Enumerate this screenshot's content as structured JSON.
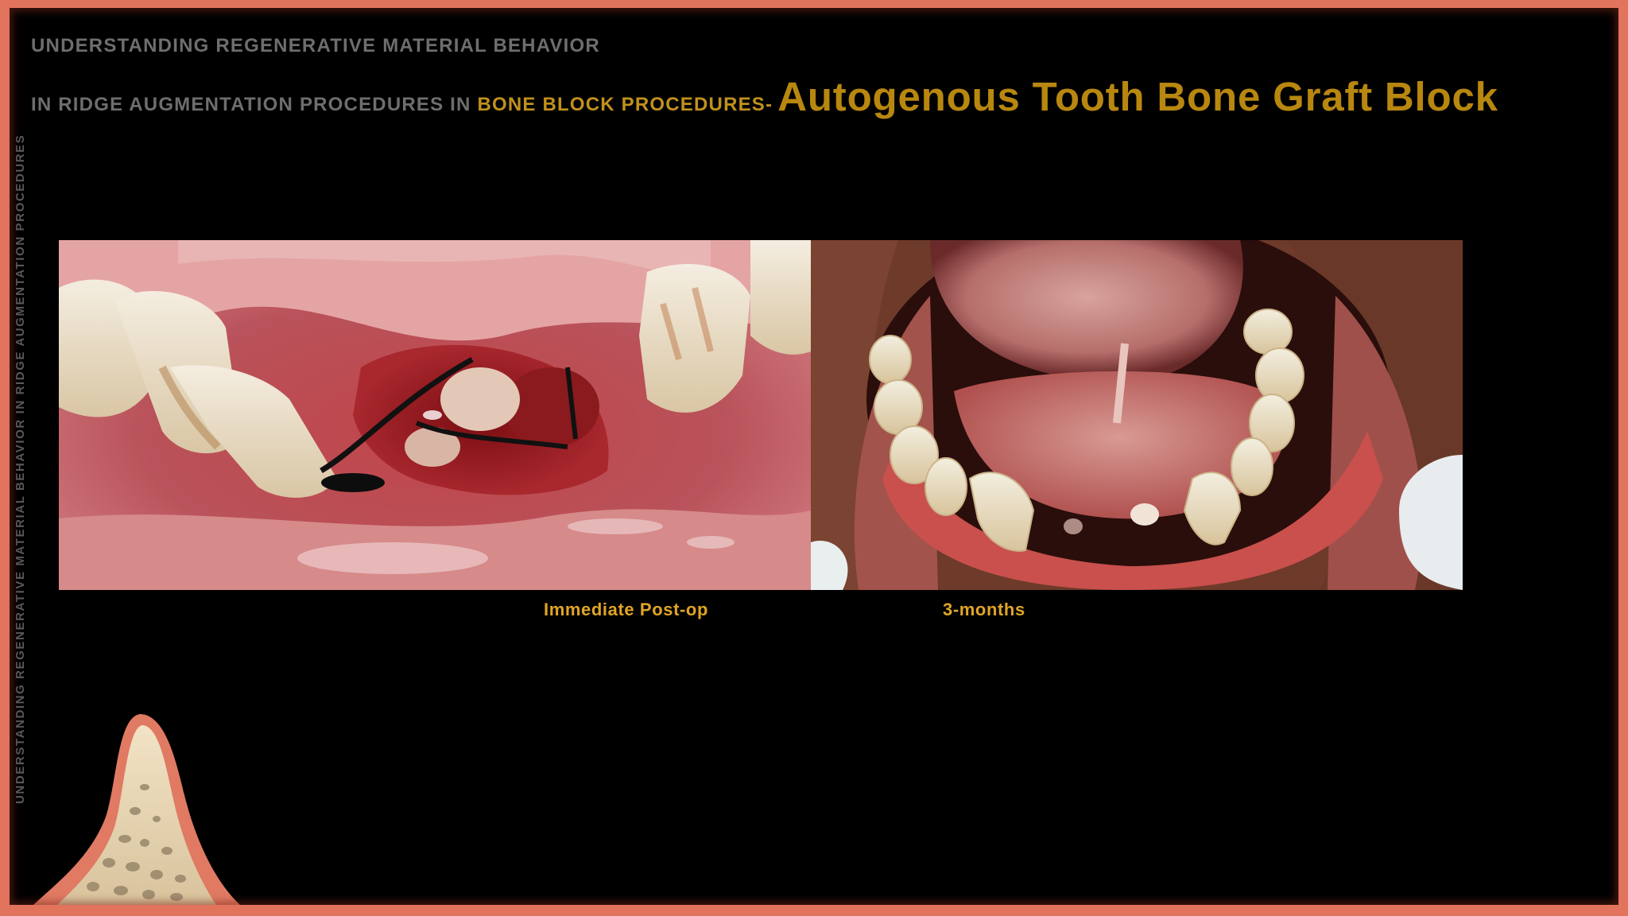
{
  "header": {
    "line1": "UNDERSTANDING REGENERATIVE MATERIAL BEHAVIOR",
    "line2_prefix": "IN RIDGE AUGMENTATION PROCEDURES IN ",
    "line2_highlight": "BONE BLOCK PROCEDURES-",
    "line2_title": "Autogenous Tooth Bone Graft Block"
  },
  "side_label": "UNDERSTANDING REGENERATIVE MATERIAL BEHAVIOR IN RIDGE AUGMENTATION PROCEDURES",
  "photos": [
    {
      "name": "immediate-post-op-photo",
      "caption": "Immediate Post-op"
    },
    {
      "name": "three-months-photo",
      "caption": "3-months"
    }
  ],
  "colors": {
    "background": "#000000",
    "border": "#e2735c",
    "header_grey": "#6e6e6e",
    "accent_gold": "#b8870f",
    "caption_gold": "#e0a526"
  },
  "icons": [
    "bone-cross-section-icon"
  ]
}
